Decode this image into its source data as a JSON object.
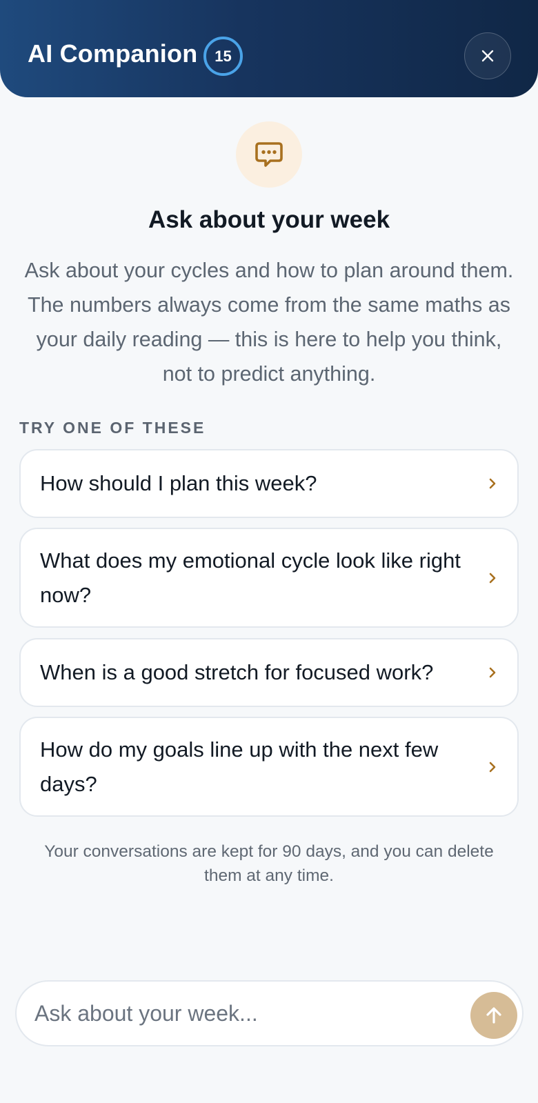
{
  "header": {
    "title": "AI Companion",
    "badge_count": "15",
    "close_icon": "close-icon"
  },
  "hero": {
    "icon": "chat-bubble-icon",
    "title": "Ask about your week",
    "description": "Ask about your cycles and how to plan around them. The numbers always come from the same maths as your daily reading — this is here to help you think, not to predict anything."
  },
  "suggestions": {
    "label": "TRY ONE OF THESE",
    "items": [
      {
        "label": "How should I plan this week?"
      },
      {
        "label": "What does my emotional cycle look like right now?"
      },
      {
        "label": "When is a good stretch for focused work?"
      },
      {
        "label": "How do my goals line up with the next few days?"
      }
    ]
  },
  "privacy_note": "Your conversations are kept for 90 days, and you can delete them at any time.",
  "composer": {
    "placeholder": "Ask about your week...",
    "value": "",
    "send_icon": "arrow-up-icon"
  },
  "colors": {
    "header_gradient_start": "#1f4a7d",
    "header_gradient_end": "#102746",
    "badge_ring": "#4aa3e8",
    "accent": "#a8701f",
    "send_button": "#d6bc96",
    "background": "#f6f8fa"
  }
}
